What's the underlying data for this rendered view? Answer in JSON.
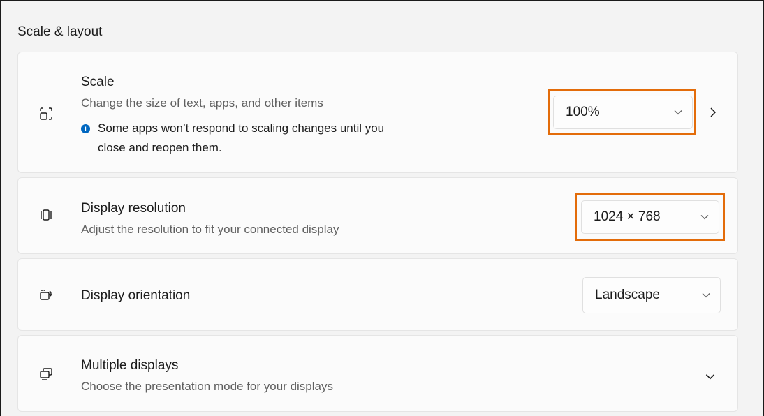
{
  "section": {
    "title": "Scale & layout"
  },
  "scale": {
    "title": "Scale",
    "subtitle": "Change the size of text, apps, and other items",
    "info_line1": "Some apps won’t respond to scaling changes until you",
    "info_line2": "close and reopen them.",
    "info_icon": "i",
    "value": "100%",
    "icon": "scale-icon"
  },
  "resolution": {
    "title": "Display resolution",
    "subtitle": "Adjust the resolution to fit your connected display",
    "value": "1024 × 768",
    "icon": "resolution-icon"
  },
  "orientation": {
    "title": "Display orientation",
    "value": "Landscape",
    "icon": "orientation-icon"
  },
  "multiple": {
    "title": "Multiple displays",
    "subtitle": "Choose the presentation mode for your displays",
    "icon": "multiple-displays-icon"
  },
  "colors": {
    "highlight": "#e36c0a",
    "info": "#0067c0"
  }
}
